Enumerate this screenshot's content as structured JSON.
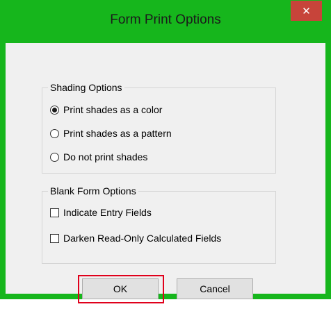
{
  "dialog": {
    "title": "Form Print Options",
    "close_symbol": "✕"
  },
  "shading_options": {
    "label": "Shading Options",
    "options": [
      {
        "label": "Print shades as a color",
        "checked": true
      },
      {
        "label": "Print shades as a pattern",
        "checked": false
      },
      {
        "label": "Do not print shades",
        "checked": false
      }
    ]
  },
  "blank_form_options": {
    "label": "Blank Form Options",
    "options": [
      {
        "label": "Indicate Entry Fields",
        "checked": false
      },
      {
        "label": "Darken Read-Only Calculated Fields",
        "checked": false
      }
    ]
  },
  "buttons": {
    "ok": "OK",
    "cancel": "Cancel"
  },
  "colors": {
    "title_bar": "#16b61c",
    "close_button": "#c7443a",
    "highlight_box": "#e0001b"
  }
}
